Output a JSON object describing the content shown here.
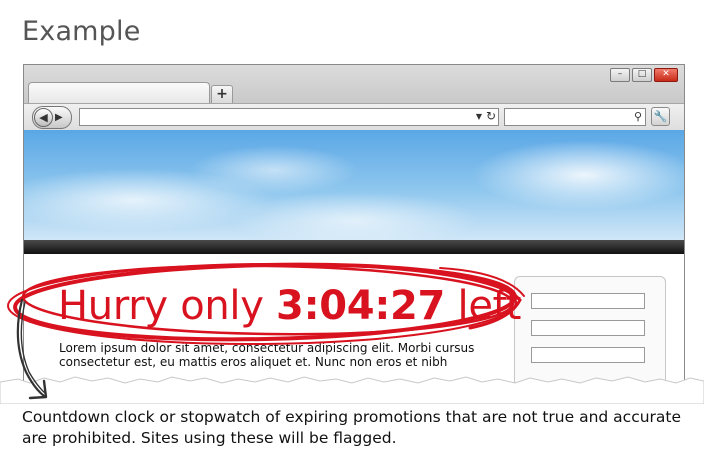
{
  "heading": "Example",
  "browser": {
    "window_buttons": {
      "minimize": "–",
      "maximize": "□",
      "close": "✕"
    },
    "new_tab_label": "+",
    "back_glyph": "◀",
    "forward_glyph": "▶",
    "address_dropdown_glyph": "▼",
    "reload_glyph": "↻",
    "search_glyph": "⚲",
    "wrench_glyph": "🔧"
  },
  "promo": {
    "prefix": "Hurry only ",
    "countdown": "3:04:27",
    "suffix": " left"
  },
  "body_text": "Lorem ipsum dolor sit amet, consectetur adipiscing elit. Morbi cursus consectetur est, eu mattis eros aliquet et. Nunc non eros et nibh",
  "caption": "Countdown clock or stopwatch of expiring promotions that are not true and accurate are prohibited. Sites using these will be flagged.",
  "colors": {
    "highlight_red": "#d8131f",
    "sky_blue": "#5aa7e6"
  }
}
